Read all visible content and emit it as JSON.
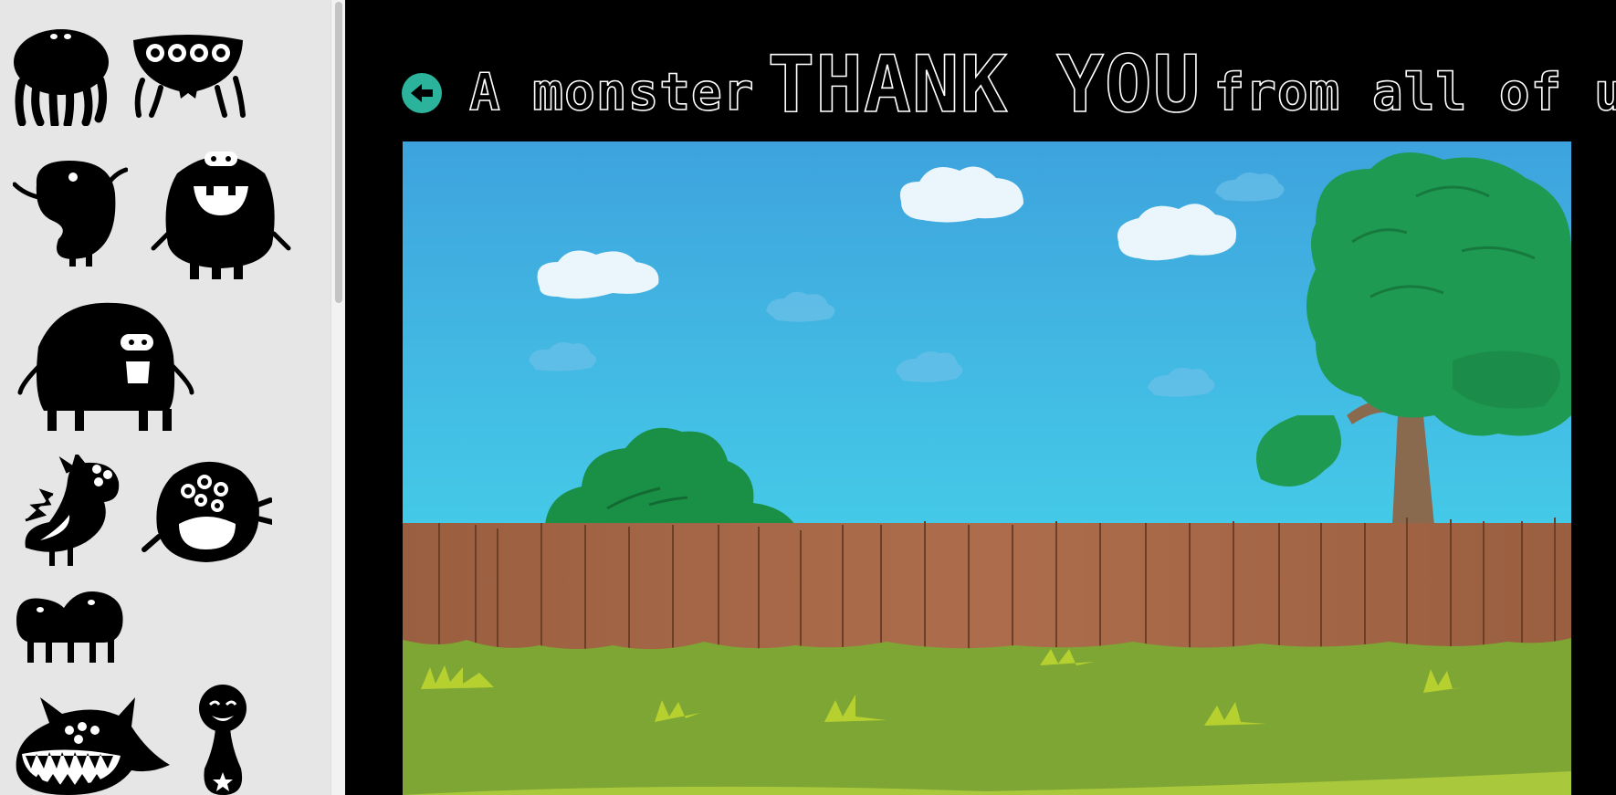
{
  "sidebar": {
    "monsters": [
      {
        "name": "jellyfish-monster"
      },
      {
        "name": "four-eyed-bug-monster"
      },
      {
        "name": "waving-blob-monster"
      },
      {
        "name": "grinning-round-monster"
      },
      {
        "name": "big-furry-monster"
      },
      {
        "name": "spiky-dragon-monster"
      },
      {
        "name": "many-eyed-fuzzy-monster"
      },
      {
        "name": "two-hump-bug-monster"
      },
      {
        "name": "toothy-horned-monster"
      },
      {
        "name": "star-belly-monster"
      }
    ]
  },
  "header": {
    "back_icon": "arrow-left-icon",
    "headline_part1": "A monster",
    "headline_big": "THANK YOU",
    "headline_part2": "from all of us!"
  },
  "scene": {
    "description_colors": {
      "sky_top": "#3ea3dd",
      "sky_bottom": "#45cbe8",
      "fence": "#a8694a",
      "grass": "#7ea634",
      "tree": "#1f9a52",
      "accent": "#2bb39b"
    }
  }
}
